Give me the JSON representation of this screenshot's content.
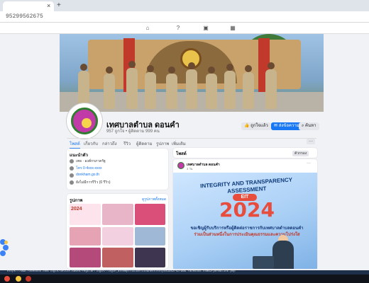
{
  "browser": {
    "tab_close": "×",
    "new_tab": "+",
    "url": "95299562675"
  },
  "cover_photo": {
    "alt": "เทศบาลตำบลดอนคำ"
  },
  "page": {
    "name": "เทศบาลตำบล ดอนคำ",
    "subtitle": "957 ถูกใจ • ผู้ติดตาม 999 คน",
    "buttons": [
      {
        "label": "ถูกใจแล้ว",
        "icon": "thumbs-up-icon"
      },
      {
        "label": "ส่งข้อความ",
        "icon": "messenger-icon"
      },
      {
        "label": "ค้นหา",
        "icon": "search-icon"
      }
    ],
    "tabs": [
      "โพสต์",
      "เกี่ยวกับ",
      "กล่าวถึง",
      "รีวิว",
      "ผู้ติดตาม",
      "รูปภาพ",
      "เพิ่มเติม"
    ],
    "more": "···"
  },
  "intro": {
    "title": "แนะนำตัว",
    "rows": [
      {
        "icon": "info-icon",
        "text": "เพจ · องค์กรภาครัฐ"
      },
      {
        "icon": "phone-icon",
        "text": "โทร 0-4xxx-xxxx"
      },
      {
        "icon": "globe-icon",
        "text": "donkham.go.th"
      },
      {
        "icon": "star-icon",
        "text": "ยังไม่มีการรีวิว (0 รีวิว)"
      }
    ]
  },
  "photos": {
    "title": "รูปภาพ",
    "see_all": "ดูรูปภาพทั้งหมด",
    "thumb_label": "2024"
  },
  "feed": {
    "title": "โพสต์",
    "filter": "ตัวกรอง"
  },
  "post": {
    "author": "เทศบาลตำบล ดอนคำ",
    "time": "3 วัน",
    "more": "···",
    "image": {
      "title": "INTEGRITY AND TRANSPARENCY ASSESSMENT",
      "badge": "EIT",
      "year": "2024",
      "line1": "ขอเชิญผู้รับบริการหรือผู้ติดต่อราชการกับเทศบาลตำบลดอนคำ",
      "line2": "ร่วมเป็นส่วนหนึ่งในการประเมินคุณธรรมและความโปร่งใส"
    }
  },
  "status": {
    "text": "https://www.facebook.com/login/device-based/regular/login/?login_attempt=1&lwv=110&next=https%3A%2F%2Fwww.facebook.com%2Fpermalink.php"
  },
  "colors": {
    "accent": "#1877f2",
    "brand_red": "#e74c3c"
  }
}
